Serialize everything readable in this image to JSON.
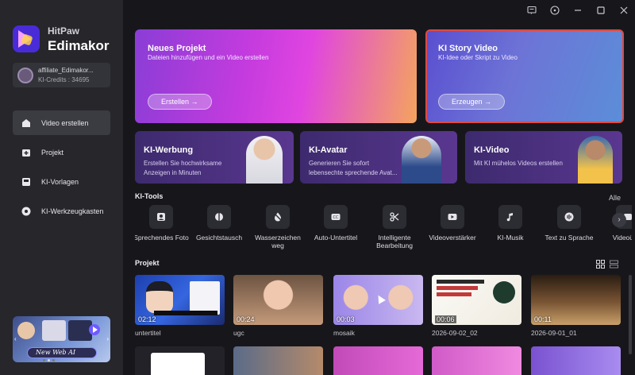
{
  "app": {
    "brand_line1": "HitPaw",
    "brand_line2": "Edimakor"
  },
  "account": {
    "name": "affiliate_Edimakor...",
    "credits": "KI-Credits : 34695"
  },
  "nav": [
    {
      "label": "Video erstellen",
      "icon": "video-create-icon",
      "active": true
    },
    {
      "label": "Projekt",
      "icon": "project-icon",
      "active": false
    },
    {
      "label": "KI-Vorlagen",
      "icon": "templates-icon",
      "active": false
    },
    {
      "label": "KI-Werkzeugkasten",
      "icon": "toolbox-icon",
      "active": false
    }
  ],
  "promo": {
    "text": "New Web AI"
  },
  "titlebar": {
    "icons": [
      "feedback-icon",
      "info-icon",
      "minimize-icon",
      "maximize-icon",
      "close-icon"
    ]
  },
  "hero": {
    "new_project": {
      "title": "Neues Projekt",
      "subtitle": "Dateien hinzufügen und ein Video erstellen",
      "button": "Erstellen →"
    },
    "story_video": {
      "title": "KI Story Video",
      "subtitle": "KI-Idee oder Skript zu Video",
      "button": "Erzeugen →"
    }
  },
  "features": [
    {
      "title": "KI-Werbung",
      "desc": "Erstellen Sie hochwirksame Anzeigen in Minuten"
    },
    {
      "title": "KI-Avatar",
      "desc": "Generieren Sie sofort lebensechte sprechende Avat..."
    },
    {
      "title": "KI-Video",
      "desc": "Mit KI mühelos Videos erstellen"
    }
  ],
  "tools": {
    "title": "KI-Tools",
    "all_label": "Alle",
    "items": [
      {
        "label": "Sprechendes Foto",
        "icon": "talking-photo-icon"
      },
      {
        "label": "Gesichtstausch",
        "icon": "face-swap-icon"
      },
      {
        "label": "Wasserzeichen weg",
        "icon": "watermark-remove-icon"
      },
      {
        "label": "Auto-Untertitel",
        "icon": "subtitle-icon"
      },
      {
        "label": "Intelligente Bearbeitung",
        "icon": "smart-edit-icon"
      },
      {
        "label": "Videoverstärker",
        "icon": "video-enhancer-icon"
      },
      {
        "label": "KI-Musik",
        "icon": "music-icon"
      },
      {
        "label": "Text zu Sprache",
        "icon": "text-to-speech-icon"
      },
      {
        "label": "Videoüber",
        "icon": "video-translate-icon"
      }
    ]
  },
  "projects": {
    "title": "Projekt",
    "items": [
      {
        "name": "untertitel",
        "duration": "02:12"
      },
      {
        "name": "ugc",
        "duration": "00:24"
      },
      {
        "name": "mosaik",
        "duration": "00:03"
      },
      {
        "name": "2026-09-02_02",
        "duration": "00:06"
      },
      {
        "name": "2026-09-01_01",
        "duration": "00:11"
      }
    ],
    "thumb_texts": {
      "t4_title": "Der ultimative Leitfaden für KI-Restaurant-Logo-Design"
    }
  }
}
